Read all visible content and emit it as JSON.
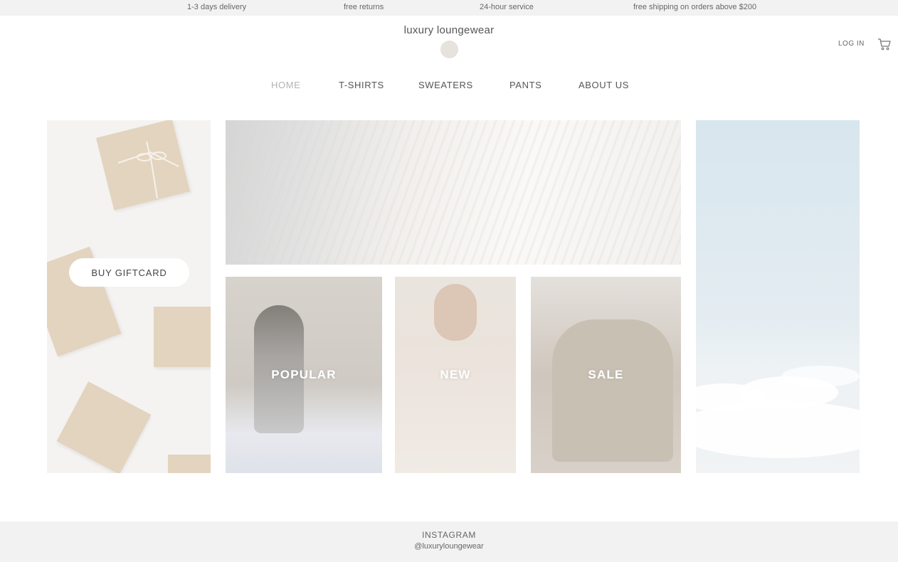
{
  "announcement_bar": {
    "items": [
      "1-3 days delivery",
      "free returns",
      "24-hour service",
      "free shipping on orders above $200"
    ]
  },
  "header": {
    "brand": "luxury loungewear",
    "login_label": "LOG IN",
    "cart_icon": "cart-icon"
  },
  "nav": {
    "items": [
      "HOME",
      "T-SHIRTS",
      "SWEATERS",
      "PANTS",
      "ABOUT US"
    ],
    "active": "HOME"
  },
  "tiles": {
    "giftcard_button": "BUY GIFTCARD",
    "popular_label": "POPULAR",
    "new_label": "NEW",
    "sale_label": "SALE"
  },
  "footer": {
    "title": "INSTAGRAM",
    "handle": "@luxuryloungewear"
  },
  "colors": {
    "topbar_bg": "#f2f2f2",
    "nav_active": "#b3b3b3",
    "logo_dot": "#e6e2de"
  }
}
